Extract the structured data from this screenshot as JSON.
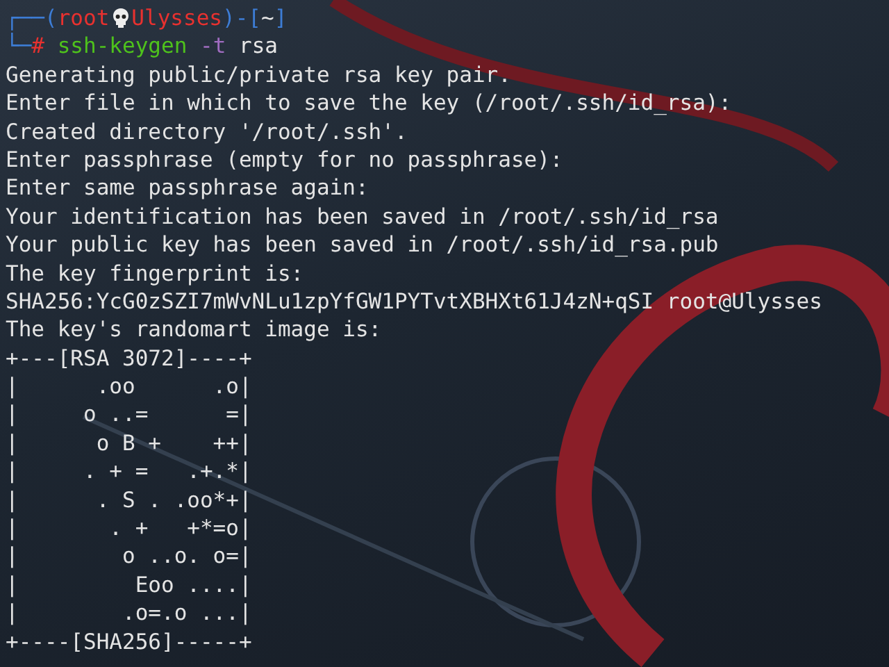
{
  "prompt": {
    "lines": [
      [
        {
          "kind": "frame",
          "text": "┌──("
        },
        {
          "kind": "user",
          "text": "root"
        },
        {
          "kind": "skull"
        },
        {
          "kind": "host",
          "text": "Ulysses"
        },
        {
          "kind": "frame",
          "text": ")-["
        },
        {
          "kind": "cwd",
          "text": "~"
        },
        {
          "kind": "frame",
          "text": "]"
        }
      ],
      [
        {
          "kind": "frame",
          "text": "└─"
        },
        {
          "kind": "symbol",
          "text": "#"
        },
        {
          "kind": "command",
          "text": "ssh-keygen"
        },
        {
          "kind": "option",
          "text": "-t"
        },
        {
          "kind": "argument",
          "text": "rsa"
        }
      ]
    ]
  },
  "output": [
    "Generating public/private rsa key pair.",
    "Enter file in which to save the key (/root/.ssh/id_rsa):",
    "Created directory '/root/.ssh'.",
    "Enter passphrase (empty for no passphrase):",
    "Enter same passphrase again:",
    "Your identification has been saved in /root/.ssh/id_rsa",
    "Your public key has been saved in /root/.ssh/id_rsa.pub",
    "The key fingerprint is:",
    "SHA256:YcG0zSZI7mWvNLu1zpYfGW1PYTvtXBHXt61J4zN+qSI root@Ulysses",
    "The key's randomart image is:"
  ],
  "randomart": [
    "+---[RSA 3072]----+",
    "|      .oo      .o|",
    "|     o ..=      =|",
    "|      o B +    ++|",
    "|     . + =   .+.*|",
    "|      . S . .oo*+|",
    "|       . +   +*=o|",
    "|        o ..o. o=|",
    "|         Eoo ....|",
    "|        .o=.o ...|",
    "+----[SHA256]-----+"
  ]
}
